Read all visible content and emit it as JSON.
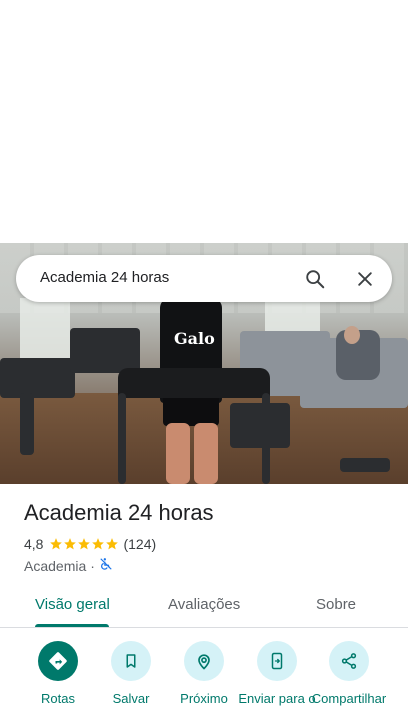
{
  "search": {
    "query": "Academia 24 horas"
  },
  "place": {
    "name": "Academia 24 horas",
    "rating": "4,8",
    "review_count": "(124)",
    "category": "Academia",
    "separator": "·",
    "stars": 5
  },
  "tabs": [
    {
      "label": "Visão geral",
      "active": true
    },
    {
      "label": "Avaliações",
      "active": false
    },
    {
      "label": "Sobre",
      "active": false
    }
  ],
  "actions": [
    {
      "label": "Rotas",
      "icon": "directions-icon"
    },
    {
      "label": "Salvar",
      "icon": "bookmark-icon"
    },
    {
      "label": "Próximo",
      "icon": "nearby-icon"
    },
    {
      "label": "Enviar para o",
      "icon": "send-to-phone-icon"
    },
    {
      "label": "Compartilhar",
      "icon": "share-icon"
    }
  ],
  "colors": {
    "accent": "#00796b",
    "star": "#fbbc04",
    "action_bg": "#d5f2f7",
    "not_accessible": "#1a73e8"
  },
  "hero_image_text": "Galo"
}
